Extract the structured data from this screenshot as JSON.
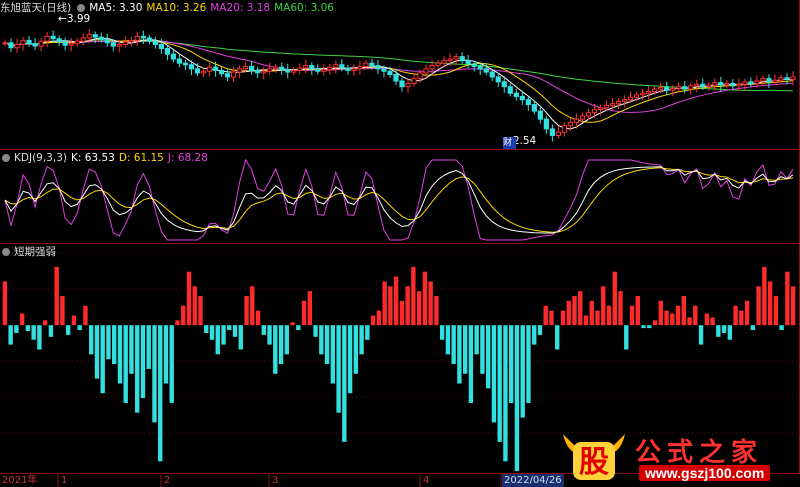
{
  "main_panel": {
    "title": "东旭蓝天(日线)",
    "ma_labels": [
      {
        "text": "MA5: 3.30",
        "color": "#ffffff"
      },
      {
        "text": "MA10: 3.26",
        "color": "#ffd700"
      },
      {
        "text": "MA20: 3.18",
        "color": "#e040e0"
      },
      {
        "text": "MA60: 3.06",
        "color": "#3fd23f"
      }
    ],
    "high_label": "3.99",
    "low_label": "2.54",
    "finance_marker": "财"
  },
  "kdj_panel": {
    "title": "KDJ(9,3,3)",
    "k_label": "K: 63.53",
    "d_label": "D: 61.15",
    "j_label": "J: 68.28",
    "colors": {
      "k": "#ffffff",
      "d": "#ffd700",
      "j": "#e040e0"
    }
  },
  "strength_panel": {
    "title": "短期强弱",
    "colors": {
      "positive": "#ff2a2a",
      "negative": "#33e0e0"
    }
  },
  "x_axis": {
    "labels": [
      "2021年",
      "1",
      "2",
      "3",
      "4"
    ],
    "cursor_date": "2022/04/26"
  },
  "watermark": {
    "glyph": "股",
    "text": "公式之家",
    "url": "www.gszj100.com"
  },
  "chart_data": [
    {
      "type": "candlestick",
      "title": "东旭蓝天(日线)",
      "series_close": [
        3.72,
        3.66,
        3.7,
        3.75,
        3.71,
        3.68,
        3.74,
        3.8,
        3.77,
        3.73,
        3.69,
        3.71,
        3.74,
        3.78,
        3.82,
        3.79,
        3.76,
        3.72,
        3.68,
        3.7,
        3.73,
        3.75,
        3.8,
        3.78,
        3.74,
        3.7,
        3.65,
        3.58,
        3.52,
        3.47,
        3.45,
        3.4,
        3.35,
        3.37,
        3.42,
        3.38,
        3.34,
        3.3,
        3.36,
        3.4,
        3.43,
        3.38,
        3.35,
        3.37,
        3.4,
        3.42,
        3.39,
        3.36,
        3.38,
        3.41,
        3.44,
        3.4,
        3.37,
        3.39,
        3.42,
        3.45,
        3.41,
        3.38,
        3.4,
        3.43,
        3.47,
        3.44,
        3.4,
        3.37,
        3.33,
        3.25,
        3.18,
        3.22,
        3.28,
        3.35,
        3.4,
        3.44,
        3.47,
        3.5,
        3.52,
        3.55,
        3.5,
        3.46,
        3.43,
        3.4,
        3.36,
        3.3,
        3.24,
        3.18,
        3.1,
        3.06,
        3.02,
        2.96,
        2.88,
        2.78,
        2.66,
        2.58,
        2.62,
        2.7,
        2.74,
        2.78,
        2.82,
        2.86,
        2.9,
        2.92,
        2.95,
        2.97,
        3.0,
        3.02,
        3.05,
        3.08,
        3.1,
        3.12,
        3.15,
        3.17,
        3.14,
        3.16,
        3.18,
        3.15,
        3.19,
        3.21,
        3.18,
        3.2,
        3.23,
        3.2,
        3.22,
        3.19,
        3.21,
        3.24,
        3.22,
        3.25,
        3.28,
        3.24,
        3.26,
        3.29,
        3.27,
        3.3
      ],
      "ma_values": {
        "MA5": 3.3,
        "MA10": 3.26,
        "MA20": 3.18,
        "MA60": 3.06
      },
      "high": 3.99,
      "low": 2.54,
      "ylim": [
        2.45,
        4.05
      ]
    },
    {
      "type": "line",
      "title": "KDJ(9,3,3)",
      "last": {
        "K": 63.53,
        "D": 61.15,
        "J": 68.28
      },
      "ylim": [
        -10,
        110
      ]
    },
    {
      "type": "bar",
      "title": "短期强弱",
      "values": [
        45,
        -20,
        -8,
        12,
        -6,
        -15,
        -25,
        5,
        -12,
        60,
        30,
        -10,
        10,
        -5,
        20,
        -30,
        -55,
        -70,
        -35,
        -40,
        -60,
        -80,
        -50,
        -90,
        -75,
        -45,
        -100,
        -140,
        -60,
        -80,
        5,
        20,
        55,
        40,
        30,
        -8,
        -15,
        -30,
        -20,
        -5,
        -12,
        -25,
        30,
        40,
        15,
        -10,
        -20,
        -50,
        -40,
        -30,
        3,
        -5,
        25,
        35,
        -12,
        -30,
        -40,
        -60,
        -90,
        -120,
        -70,
        -50,
        -30,
        -15,
        10,
        15,
        45,
        40,
        50,
        25,
        40,
        60,
        35,
        55,
        45,
        30,
        -15,
        -30,
        -40,
        -60,
        -50,
        -80,
        -30,
        -50,
        -65,
        -100,
        -120,
        -140,
        -80,
        -150,
        -95,
        -80,
        -20,
        -10,
        20,
        15,
        -25,
        15,
        25,
        30,
        35,
        10,
        25,
        15,
        40,
        20,
        55,
        35,
        -25,
        20,
        30,
        -3,
        -3,
        5,
        25,
        15,
        12,
        20,
        30,
        8,
        20,
        -20,
        12,
        8,
        -12,
        -8,
        -15,
        20,
        15,
        25,
        -5,
        40,
        60,
        45,
        30,
        -5,
        55,
        40
      ],
      "ylim": [
        -150,
        65
      ]
    }
  ]
}
